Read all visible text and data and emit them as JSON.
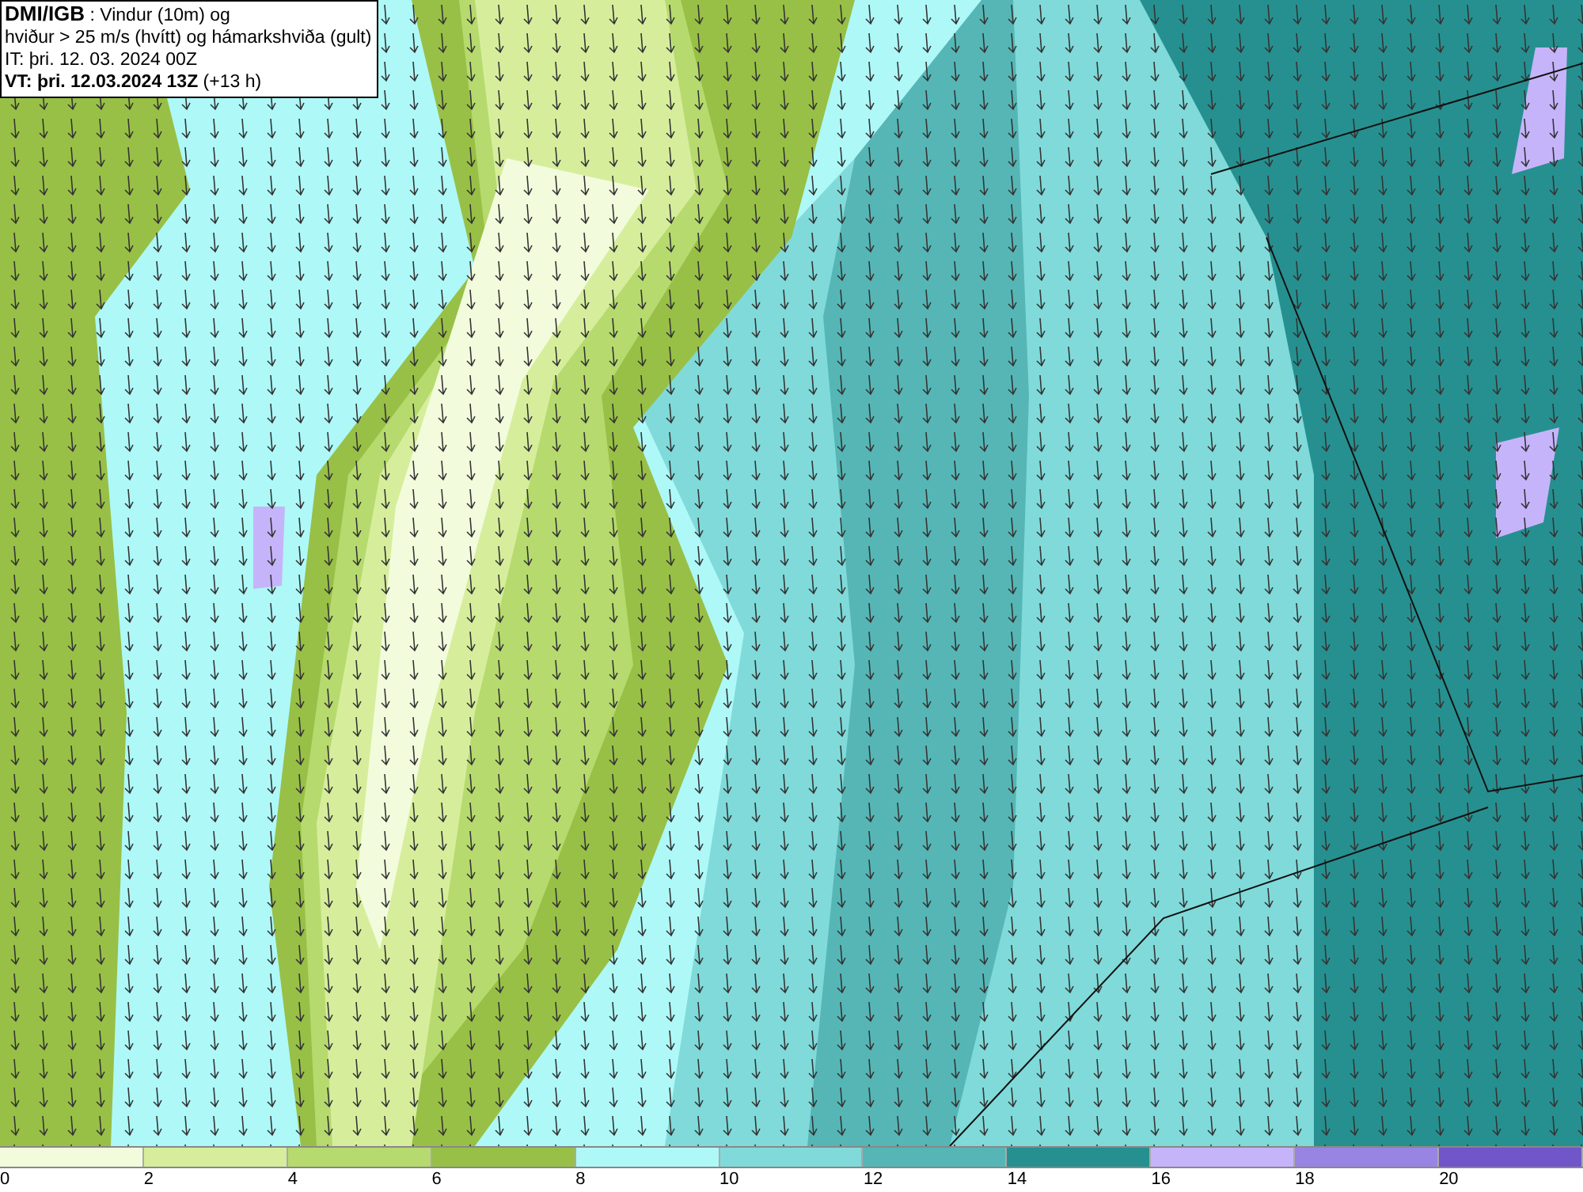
{
  "title_box": {
    "source": "DMI/IGB",
    "lines": [
      " : Vindur (10m) og",
      "hviður > 25 m/s (hvítt) og hámarkshviða (gult)",
      "IT: þri. 12. 03. 2024 00Z"
    ],
    "valid_time": "VT: þri. 12.03.2024 13Z",
    "lead": " (+13 h)"
  },
  "legend": {
    "bins": [
      {
        "color": "#f2fcdc",
        "tick": "0"
      },
      {
        "color": "#d6ee9c",
        "tick": "2"
      },
      {
        "color": "#b6da6e",
        "tick": "4"
      },
      {
        "color": "#98c046",
        "tick": "6"
      },
      {
        "color": "#aef8f8",
        "tick": "8"
      },
      {
        "color": "#80dada",
        "tick": "10"
      },
      {
        "color": "#56b6b6",
        "tick": "12"
      },
      {
        "color": "#269090",
        "tick": "14"
      },
      {
        "color": "#c6b4fa",
        "tick": "16"
      },
      {
        "color": "#9884e2",
        "tick": "18"
      },
      {
        "color": "#7056c8",
        "tick": "20"
      }
    ]
  }
}
